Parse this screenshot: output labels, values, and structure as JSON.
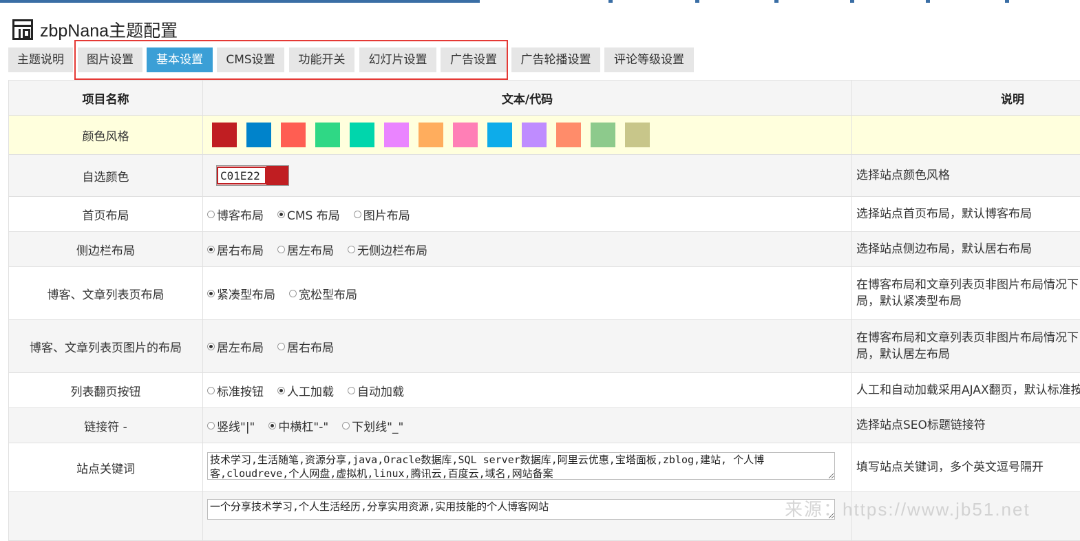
{
  "header": {
    "title": "zbpNana主题配置"
  },
  "tabs": [
    {
      "label": "主题说明",
      "active": false
    },
    {
      "label": "图片设置",
      "active": false
    },
    {
      "label": "基本设置",
      "active": true
    },
    {
      "label": "CMS设置",
      "active": false
    },
    {
      "label": "功能开关",
      "active": false
    },
    {
      "label": "幻灯片设置",
      "active": false
    },
    {
      "label": "广告设置",
      "active": false
    },
    {
      "label": "广告轮播设置",
      "active": false
    },
    {
      "label": "评论等级设置",
      "active": false
    }
  ],
  "table": {
    "headers": {
      "name": "项目名称",
      "value": "文本/代码",
      "desc": "说明"
    },
    "color_style": {
      "name": "颜色风格",
      "swatches": [
        "#c01e22",
        "#0083cb",
        "#ff5e52",
        "#2fd885",
        "#00d6ac",
        "#ea84ff",
        "#ffad5d",
        "#ff7fb6",
        "#0dacea",
        "#bf8cff",
        "#ff8c6a",
        "#8dca8c",
        "#c8c68a"
      ]
    },
    "custom_color": {
      "name": "自选颜色",
      "value": "C01E22",
      "preview_color": "#c01e22",
      "desc": "选择站点颜色风格"
    },
    "home_layout": {
      "name": "首页布局",
      "options": [
        {
          "label": "博客布局",
          "checked": false
        },
        {
          "label": "CMS 布局",
          "checked": true
        },
        {
          "label": "图片布局",
          "checked": false
        }
      ],
      "desc": "选择站点首页布局，默认博客布局"
    },
    "sidebar_layout": {
      "name": "侧边栏布局",
      "options": [
        {
          "label": "居右布局",
          "checked": true
        },
        {
          "label": "居左布局",
          "checked": false
        },
        {
          "label": "无侧边栏布局",
          "checked": false
        }
      ],
      "desc": "选择站点侧边布局，默认居右布局"
    },
    "list_layout": {
      "name": "博客、文章列表页布局",
      "options": [
        {
          "label": "紧凑型布局",
          "checked": true
        },
        {
          "label": "宽松型布局",
          "checked": false
        }
      ],
      "desc_line1": "在博客布局和文章列表页非图片布局情况下",
      "desc_line2": "局，默认紧凑型布局"
    },
    "list_image_layout": {
      "name": "博客、文章列表页图片的布局",
      "options": [
        {
          "label": "居左布局",
          "checked": true
        },
        {
          "label": "居右布局",
          "checked": false
        }
      ],
      "desc_line1": "在博客布局和文章列表页非图片布局情况下",
      "desc_line2": "局，默认居左布局"
    },
    "pagination": {
      "name": "列表翻页按钮",
      "options": [
        {
          "label": "标准按钮",
          "checked": false
        },
        {
          "label": "人工加载",
          "checked": true
        },
        {
          "label": "自动加载",
          "checked": false
        }
      ],
      "desc": "人工和自动加载采用AJAX翻页，默认标准按钮"
    },
    "link_char": {
      "name": "链接符 -",
      "options": [
        {
          "label": "竖线\"|\"",
          "checked": false
        },
        {
          "label": "中横杠\"-\"",
          "checked": true
        },
        {
          "label": "下划线\"_\"",
          "checked": false
        }
      ],
      "desc": "选择站点SEO标题链接符"
    },
    "keywords": {
      "name": "站点关键词",
      "value": "技术学习,生活随笔,资源分享,java,Oracle数据库,SQL server数据库,阿里云优惠,宝塔面板,zblog,建站, 个人博客,cloudreve,个人网盘,虚拟机,linux,腾讯云,百度云,域名,网站备案",
      "desc": "填写站点关键词，多个英文逗号隔开"
    },
    "description": {
      "value": "一个分享技术学习,个人生活经历,分享实用资源,实用技能的个人博客网站"
    }
  },
  "watermark": "来源：https://www.jb51.net"
}
